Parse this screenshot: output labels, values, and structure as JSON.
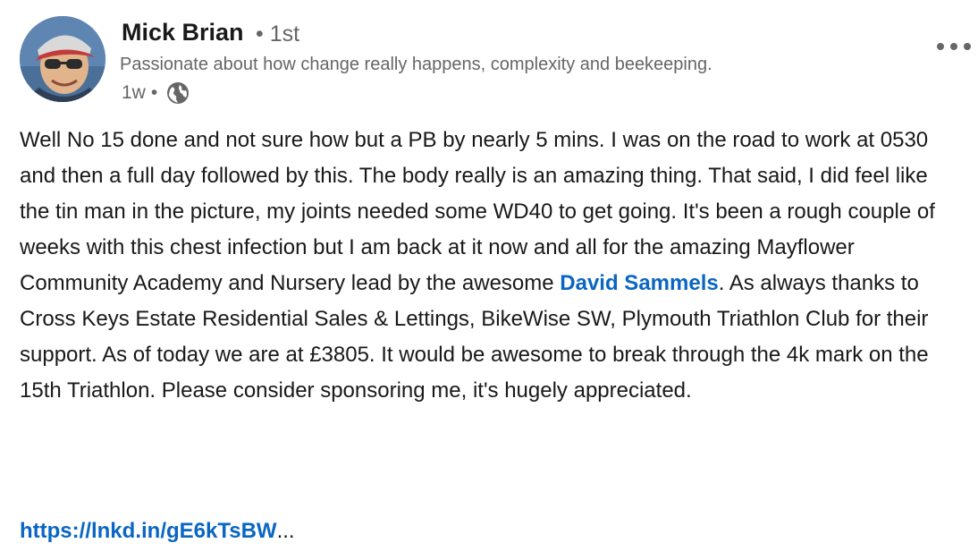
{
  "author": {
    "name": "Mick Brian",
    "degree": "• 1st",
    "headline": "Passionate about how change really happens, complexity and beekeeping.",
    "time": "1w",
    "time_separator": "•",
    "visibility_icon": "globe-icon",
    "avatar_icon": "profile-photo"
  },
  "menu": {
    "more_icon": "more-horizontal-icon"
  },
  "post": {
    "text_before_mention": "Well No 15 done and not sure how but a PB by nearly 5 mins. I was on the road to work at 0530 and then a full day followed by this. The body really is an amazing thing. That said, I did feel like the tin man in the picture, my joints needed some WD40 to get going. It's been a rough couple of weeks with this chest infection but I am back at it now and all for the amazing Mayflower Community Academy and Nursery lead by the awesome ",
    "mention": "David Sammels",
    "text_after_mention": ". As always thanks to Cross Keys Estate Residential Sales & Lettings, BikeWise SW, Plymouth Triathlon Club for their support. As of today we are at £3805. It would be awesome to break through the 4k mark on the 15th Triathlon. Please consider sponsoring me, it's hugely appreciated.",
    "link": "https://lnkd.in/gE6kTsBW",
    "link_ellipsis": "..."
  },
  "colors": {
    "link": "#0a66c2",
    "text": "#191919",
    "muted": "#666666"
  }
}
